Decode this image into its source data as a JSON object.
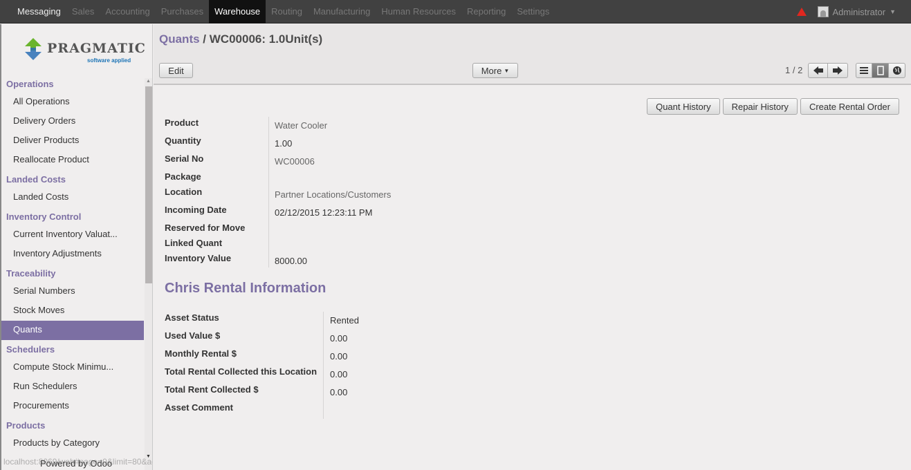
{
  "topmenu": {
    "items": [
      {
        "label": "Messaging"
      },
      {
        "label": "Sales"
      },
      {
        "label": "Accounting"
      },
      {
        "label": "Purchases"
      },
      {
        "label": "Warehouse"
      },
      {
        "label": "Routing"
      },
      {
        "label": "Manufacturing"
      },
      {
        "label": "Human Resources"
      },
      {
        "label": "Reporting"
      },
      {
        "label": "Settings"
      }
    ],
    "active": "Warehouse",
    "user": "Administrator",
    "alert_color": "#e0271f"
  },
  "logo": {
    "text": "PRAGMATIC",
    "sub": "software applied"
  },
  "sidebar": {
    "operations": {
      "title": "Operations",
      "items": [
        "All Operations",
        "Delivery Orders",
        "Deliver Products",
        "Reallocate Product"
      ]
    },
    "landed": {
      "title": "Landed Costs",
      "items": [
        "Landed Costs"
      ]
    },
    "inventory": {
      "title": "Inventory Control",
      "items": [
        "Current Inventory Valuat...",
        "Inventory Adjustments"
      ]
    },
    "trace": {
      "title": "Traceability",
      "items": [
        "Serial Numbers",
        "Stock Moves",
        "Quants"
      ]
    },
    "sched": {
      "title": "Schedulers",
      "items": [
        "Compute Stock Minimu...",
        "Run Schedulers",
        "Procurements"
      ]
    },
    "products": {
      "title": "Products",
      "items": [
        "Products by Category"
      ]
    },
    "active_item": "Quants",
    "powered_by": "Powered by Odoo",
    "status_url": "localhost:8069/web#page=0&limit=80&action"
  },
  "header": {
    "breadcrumb_parent": "Quants",
    "breadcrumb_sep": "/",
    "record_title": "WC00006: 1.0Unit(s)",
    "edit_label": "Edit",
    "more_label": "More",
    "pager": "1 / 2"
  },
  "actions": {
    "quant_history": "Quant History",
    "repair_history": "Repair History",
    "create_rental_order": "Create Rental Order"
  },
  "fields": {
    "product": {
      "label": "Product",
      "value": "Water Cooler"
    },
    "quantity": {
      "label": "Quantity",
      "value": "1.00"
    },
    "serial": {
      "label": "Serial No",
      "value": "WC00006"
    },
    "package": {
      "label": "Package",
      "value": ""
    },
    "location": {
      "label": "Location",
      "value": "Partner Locations/Customers"
    },
    "incoming": {
      "label": "Incoming Date",
      "value": "02/12/2015 12:23:11 PM"
    },
    "reserved": {
      "label": "Reserved for Move",
      "value": ""
    },
    "linked": {
      "label": "Linked Quant",
      "value": ""
    },
    "inv_value": {
      "label": "Inventory Value",
      "value": "8000.00"
    }
  },
  "rental": {
    "title": "Chris Rental Information",
    "asset_status": {
      "label": "Asset Status",
      "value": "Rented"
    },
    "used_value": {
      "label": "Used Value $",
      "value": "0.00"
    },
    "monthly_rental": {
      "label": "Monthly Rental $",
      "value": "0.00"
    },
    "total_location": {
      "label": "Total Rental Collected this Location",
      "value": "0.00"
    },
    "total_rent": {
      "label": "Total Rent Collected $",
      "value": "0.00"
    },
    "asset_comment": {
      "label": "Asset Comment",
      "value": ""
    }
  },
  "colors": {
    "accent": "#7c6fa3",
    "topbar": "#414141"
  }
}
